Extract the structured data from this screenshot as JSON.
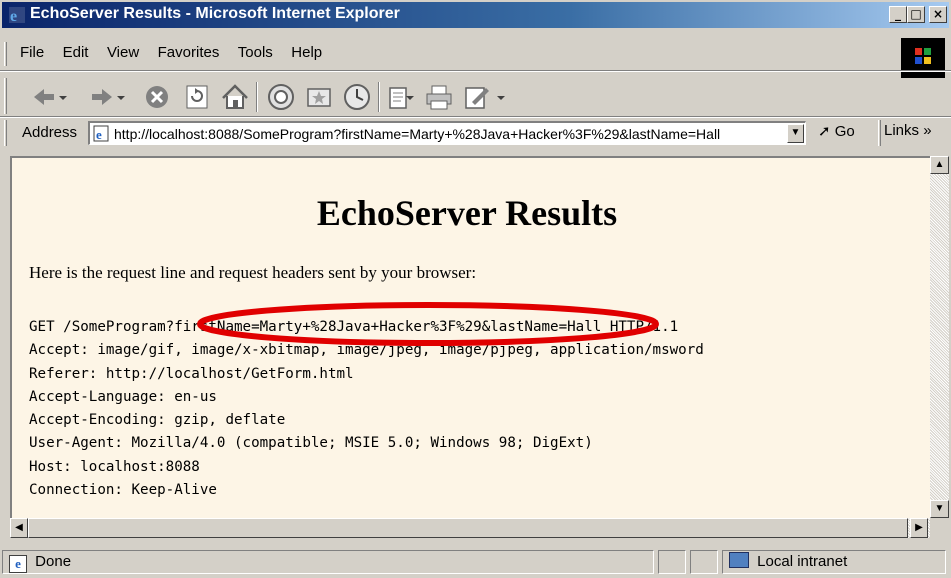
{
  "window": {
    "title": "EchoServer Results - Microsoft Internet Explorer",
    "minimize_glyph": "_",
    "maximize_glyph": "□",
    "close_glyph": "×"
  },
  "menu": {
    "items": [
      "File",
      "Edit",
      "View",
      "Favorites",
      "Tools",
      "Help"
    ]
  },
  "toolbar": {
    "buttons": [
      "back-icon",
      "forward-icon",
      "stop-icon",
      "refresh-icon",
      "home-icon",
      "search-icon",
      "favorites-icon",
      "history-icon",
      "mail-icon",
      "print-icon",
      "edit-icon",
      "discuss-icon"
    ]
  },
  "address_bar": {
    "label": "Address",
    "url": "http://localhost:8088/SomeProgram?firstName=Marty+%28Java+Hacker%3F%29&lastName=Hall",
    "go_label": "Go",
    "links_label": "Links",
    "links_glyph": "»"
  },
  "page": {
    "heading": "EchoServer Results",
    "intro": "Here is the request line and request headers sent by your browser:",
    "request_lines": [
      "GET /SomeProgram?firstName=Marty+%28Java+Hacker%3F%29&lastName=Hall HTTP/1.1",
      "Accept: image/gif, image/x-xbitmap, image/jpeg, image/pjpeg, application/msword",
      "Referer: http://localhost/GetForm.html",
      "Accept-Language: en-us",
      "Accept-Encoding: gzip, deflate",
      "User-Agent: Mozilla/4.0 (compatible; MSIE 5.0; Windows 98; DigExt)",
      "Host: localhost:8088",
      "Connection: Keep-Alive"
    ],
    "annotation_color": "#e00000"
  },
  "status_bar": {
    "status": "Done",
    "zone": "Local intranet"
  },
  "colors": {
    "titlebar_start": "#0a246a",
    "titlebar_end": "#a6caf0",
    "page_background": "#fdf5e6",
    "chrome": "#d4d0c8"
  }
}
